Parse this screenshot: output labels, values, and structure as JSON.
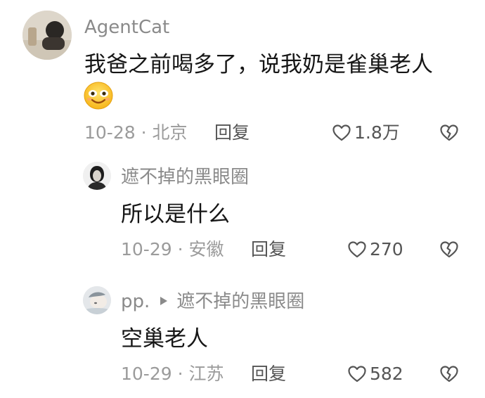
{
  "comments": [
    {
      "username": "AgentCat",
      "text": "我爸之前喝多了，说我奶是雀巢老人",
      "emoji": "smile-emoji",
      "date": "10-28 · 北京",
      "reply_label": "回复",
      "likes": "1.8万"
    },
    {
      "username": "遮不掉的黑眼圈",
      "text": "所以是什么",
      "date": "10-29 · 安徽",
      "reply_label": "回复",
      "likes": "270"
    },
    {
      "username": "pp.",
      "reply_to": "遮不掉的黑眼圈",
      "text": "空巢老人",
      "date": "10-29 · 江苏",
      "reply_label": "回复",
      "likes": "582"
    }
  ],
  "colors": {
    "username": "#8a8a8a",
    "text": "#161616",
    "meta": "#9b9b9b",
    "action": "#555555"
  }
}
